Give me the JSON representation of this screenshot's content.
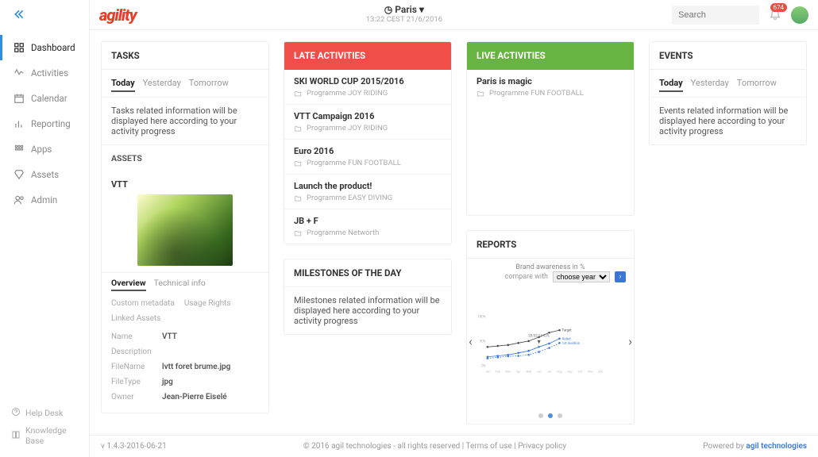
{
  "brand": "agility",
  "location": {
    "name": "Paris",
    "time": "13:22 CEST 21/6/2016",
    "clock_icon": "clock-icon"
  },
  "search": {
    "placeholder": "Search"
  },
  "notifications": {
    "count": "674"
  },
  "nav": [
    {
      "label": "Dashboard",
      "icon": "dashboard-icon",
      "active": true
    },
    {
      "label": "Activities",
      "icon": "activities-icon"
    },
    {
      "label": "Calendar",
      "icon": "calendar-icon"
    },
    {
      "label": "Reporting",
      "icon": "reporting-icon"
    },
    {
      "label": "Apps",
      "icon": "apps-icon"
    },
    {
      "label": "Assets",
      "icon": "diamond-icon"
    },
    {
      "label": "Admin",
      "icon": "admin-icon"
    }
  ],
  "nav_footer": [
    {
      "label": "Help Desk",
      "icon": "help-icon"
    },
    {
      "label": "Knowledge Base",
      "icon": "book-icon"
    }
  ],
  "tasks": {
    "title": "TASKS",
    "tabs": [
      "Today",
      "Yesterday",
      "Tomorrow"
    ],
    "active_tab": "Today",
    "body": "Tasks related information will be displayed here according to your activity progress"
  },
  "assets_head": "ASSETS",
  "asset": {
    "title": "VTT",
    "tabs": [
      "Overview",
      "Technical info"
    ],
    "active_tab": "Overview",
    "meta_links": [
      "Custom metadata",
      "Usage Rights",
      "Linked Assets"
    ],
    "fields": [
      {
        "k": "Name",
        "v": "VTT"
      },
      {
        "k": "Description",
        "v": ""
      },
      {
        "k": "FileName",
        "v": "lvtt foret brume.jpg"
      },
      {
        "k": "FileType",
        "v": "jpg"
      },
      {
        "k": "Owner",
        "v": "Jean-Pierre Eiselé"
      }
    ]
  },
  "late_activities": {
    "title": "LATE ACTIVITIES",
    "items": [
      {
        "title": "SKI WORLD CUP 2015/2016",
        "sub": "Programme JOY RIDING"
      },
      {
        "title": "VTT Campaign 2016",
        "sub": "Programme JOY RIDING"
      },
      {
        "title": "Euro 2016",
        "sub": "Programme FUN FOOTBALL"
      },
      {
        "title": "Launch the product!",
        "sub": "Programme EASY DIVING"
      },
      {
        "title": "JB + F",
        "sub": "Programme Networth"
      }
    ]
  },
  "live_activities": {
    "title": "LIVE ACTIVITIES",
    "items": [
      {
        "title": "Paris is magic",
        "sub": "Programme FUN FOOTBALL"
      }
    ]
  },
  "milestones": {
    "title": "MILESTONES OF THE DAY",
    "body": "Milestones related information will be displayed here according to your activity progress"
  },
  "reports": {
    "title": "REPORTS",
    "compare_label": "compare with",
    "compare_value": "choose year",
    "chart_title": "Brand awareness in %"
  },
  "events": {
    "title": "EVENTS",
    "tabs": [
      "Today",
      "Yesterday",
      "Tomorrow"
    ],
    "active_tab": "Today",
    "body": "Events related information will be displayed here according to your activity progress"
  },
  "footer": {
    "version": "v 1.4.3-2016-06-21",
    "mid": "© 2016 agil technologies - all rights reserved | Terms of use | Privacy policy",
    "right_prefix": "Powered by ",
    "right_brand": "agil technologies"
  },
  "chart_data": {
    "type": "line",
    "title": "Brand awareness in %",
    "xlabel": "",
    "ylabel": "%",
    "ylim": [
      0,
      100
    ],
    "x": [
      "Jan",
      "Feb",
      "Mar",
      "Apr",
      "May",
      "Jun",
      "Jul",
      "Aug",
      "Sep",
      "Oct",
      "Nov",
      "Dec"
    ],
    "series": [
      {
        "name": "Target",
        "color": "#4a4a4a",
        "values": [
          38,
          40,
          42,
          46,
          50,
          58,
          67,
          72,
          null,
          null,
          null,
          null
        ]
      },
      {
        "name": "Aided",
        "color": "#3b78d6",
        "values": [
          18,
          20,
          22,
          26,
          30,
          38,
          45,
          55,
          null,
          null,
          null,
          null
        ]
      },
      {
        "name": "1st mention",
        "color": "#3b78d6",
        "dashed": true,
        "values": [
          15,
          17,
          19,
          20,
          22,
          28,
          36,
          46,
          null,
          null,
          null,
          null
        ]
      }
    ],
    "annotations": [
      {
        "label": "28/02/15 43%",
        "x": "Jun",
        "y": 43
      }
    ]
  }
}
